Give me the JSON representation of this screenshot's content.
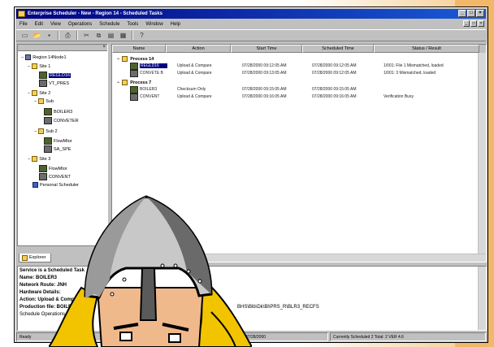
{
  "window": {
    "title": "Enterprise Scheduler - New - Region 14 - Scheduled Tasks",
    "controls": [
      "_",
      "□",
      "×"
    ]
  },
  "menubar": {
    "items": [
      "File",
      "Edit",
      "View",
      "Operations",
      "Schedule",
      "Tools",
      "Window",
      "Help"
    ],
    "mdi_controls": [
      "_",
      "□",
      "×"
    ]
  },
  "toolbar": {
    "icons": [
      "new-icon",
      "open-icon",
      "save-icon",
      "print-icon",
      "cut-icon",
      "copy-icon",
      "paste-icon",
      "properties-icon",
      "help-icon"
    ]
  },
  "tree": {
    "nodes": [
      {
        "label": "Region 14Node1",
        "icon": "plant-icon"
      },
      {
        "label": "Site 1",
        "icon": "folder-icon"
      },
      {
        "label": "REGLD16",
        "icon": "device-icon",
        "selected": true
      },
      {
        "label": "VT_PRES",
        "icon": "device-icon"
      },
      {
        "label": "Site 2",
        "icon": "folder-icon"
      },
      {
        "label": "Sub",
        "icon": "folder-icon"
      },
      {
        "label": "BOILER3",
        "icon": "device-icon"
      },
      {
        "label": "CONVETER",
        "icon": "device-icon"
      },
      {
        "label": "Sub 2",
        "icon": "folder-icon"
      },
      {
        "label": "FlowMtor",
        "icon": "device-icon"
      },
      {
        "label": "SA_SPE",
        "icon": "device-icon"
      },
      {
        "label": "Site 3",
        "icon": "folder-icon"
      },
      {
        "label": "FlowMtor",
        "icon": "device-icon"
      },
      {
        "label": "CONVENT",
        "icon": "device-icon"
      },
      {
        "label": "Personal Scheduler",
        "icon": "person-icon"
      }
    ],
    "tab_label": "Explorer"
  },
  "list": {
    "columns": [
      "Name",
      "Action",
      "Start Time",
      "Scheduled Time",
      "Status / Result"
    ],
    "groups": [
      {
        "label": "Process 14",
        "rows": [
          {
            "name": "REGLD16",
            "action": "Upload & Compare",
            "start": "07/28/2000 09:12:05 AM",
            "sched": "07/28/2000 09:12:05 AM",
            "status": "1/001: File 1 Mismatched, loaded"
          },
          {
            "name": "CONVETE B",
            "action": "Upload & Compare",
            "start": "07/28/2000 09:13:05 AM",
            "sched": "07/28/2000 09:12:05 AM",
            "status": "1/001: 3 Mismatched, loaded"
          }
        ]
      },
      {
        "label": "Process 7",
        "rows": [
          {
            "name": "BOILER3",
            "action": "Checksum Only",
            "start": "07/28/2000 09:15:05 AM",
            "sched": "07/28/2000 09:15:05 AM",
            "status": ""
          },
          {
            "name": "CONVENT",
            "action": "Upload & Compare",
            "start": "07/28/2000 09:16:05 AM",
            "sched": "07/28/2000 09:16:05 AM",
            "status": "Verification Busy"
          }
        ]
      }
    ]
  },
  "detail": {
    "lines": [
      {
        "text": "Service is a Scheduled Task",
        "bold": true
      },
      {
        "text": "Name: BOILER3",
        "bold": true
      },
      {
        "text": "Network Route: JNH",
        "bold": true
      },
      {
        "text": "Hardware Details:",
        "bold": true
      },
      {
        "text": "Action: Upload & Compare",
        "bold": true
      },
      {
        "text": "Production file: BOILER3",
        "bold": true
      },
      {
        "text": "Schedule Operations",
        "bold": false
      }
    ],
    "path_fragment": "BHS\\Blb\\Dk\\Bl\\PRS_R\\BLR3_RECFS"
  },
  "statusbar": {
    "panels": [
      "Ready",
      "07/28/2000",
      "Currently Scheduled 2 Total: 2 VER 4.6"
    ]
  }
}
